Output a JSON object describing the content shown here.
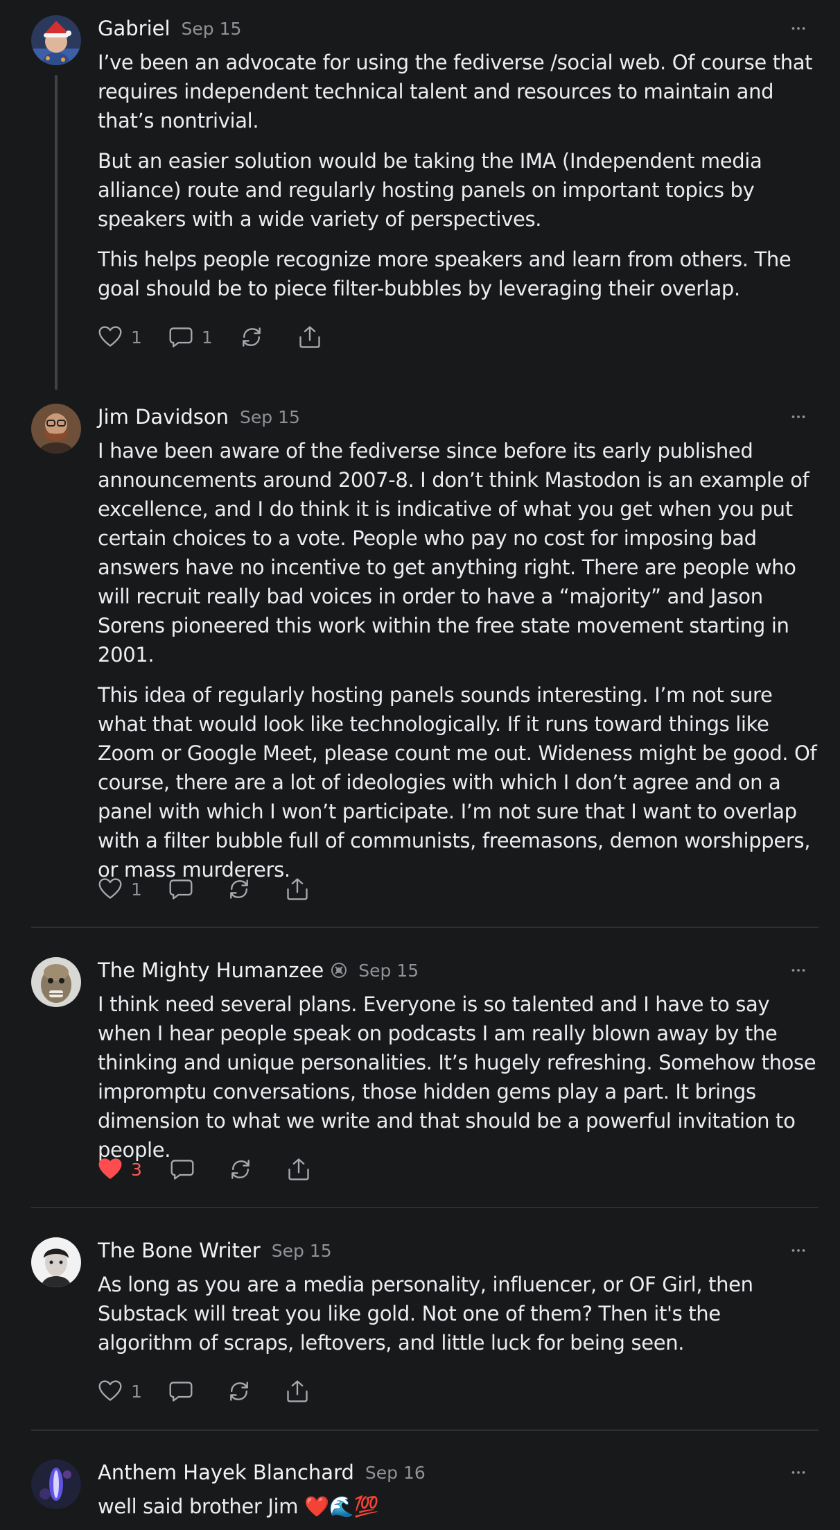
{
  "comments": [
    {
      "author": "Gabriel",
      "date": "Sep 15",
      "paragraphs": [
        "I’ve been an advocate for using the fediverse /social web. Of course that requires independent technical talent and resources to maintain and that’s nontrivial.",
        "But an easier solution would be taking the IMA (Independent media alliance) route and regularly hosting panels on important topics by speakers with a wide variety of perspectives.",
        "This helps people recognize more speakers and learn from others. The goal should be to piece filter-bubbles by leveraging their overlap."
      ],
      "likes": "1",
      "replies": "1"
    },
    {
      "author": "Jim Davidson",
      "date": "Sep 15",
      "paragraphs": [
        "I have been aware of the fediverse since before its early published announcements around 2007-8. I don’t think Mastodon is an example of excellence, and I do think it is indicative of what you get when you put certain choices to a vote. People who pay no cost for imposing bad answers have no incentive to get anything right. There are people who will recruit really bad voices in order to have a “majority” and Jason Sorens pioneered this work within the free state movement starting in 2001.",
        "This idea of regularly hosting panels sounds interesting. I’m not sure what that would look like technologically. If it runs toward things like Zoom or Google Meet, please count me out. Wideness might be good. Of course, there are a lot of ideologies with which I don’t agree and on a panel with which I won’t participate. I’m not sure that I want to overlap with a filter bubble full of communists, freemasons, demon worshippers, or mass murderers."
      ],
      "likes": "1"
    },
    {
      "author": "The Mighty Humanzee",
      "date": "Sep 15",
      "paragraphs": [
        "I think need several plans. Everyone is so talented and I have to say when I hear people speak on podcasts I am really blown away by the thinking and unique personalities. It’s hugely refreshing. Somehow those impromptu conversations, those hidden gems play a part. It brings dimension to what we write and that should be a powerful invitation to people."
      ],
      "likes": "3"
    },
    {
      "author": "The Bone Writer",
      "date": "Sep 15",
      "paragraphs": [
        "As long as you are a media personality, influencer, or OF Girl, then Substack will treat you like gold. Not one of them? Then it's the algorithm of scraps, leftovers, and little luck for being seen."
      ],
      "likes": "1"
    },
    {
      "author": "Anthem Hayek Blanchard",
      "date": "Sep 16",
      "paragraphs": [
        "well said brother Jim ❤️🌊💯"
      ]
    }
  ],
  "colors": {
    "background": "#18191b",
    "liked_heart": "#ff4d4f",
    "muted": "#8f9297"
  },
  "icons": [
    "avatar",
    "heart-icon",
    "comment-icon",
    "restack-icon",
    "share-icon",
    "more-icon",
    "subscriber-badge-icon"
  ]
}
